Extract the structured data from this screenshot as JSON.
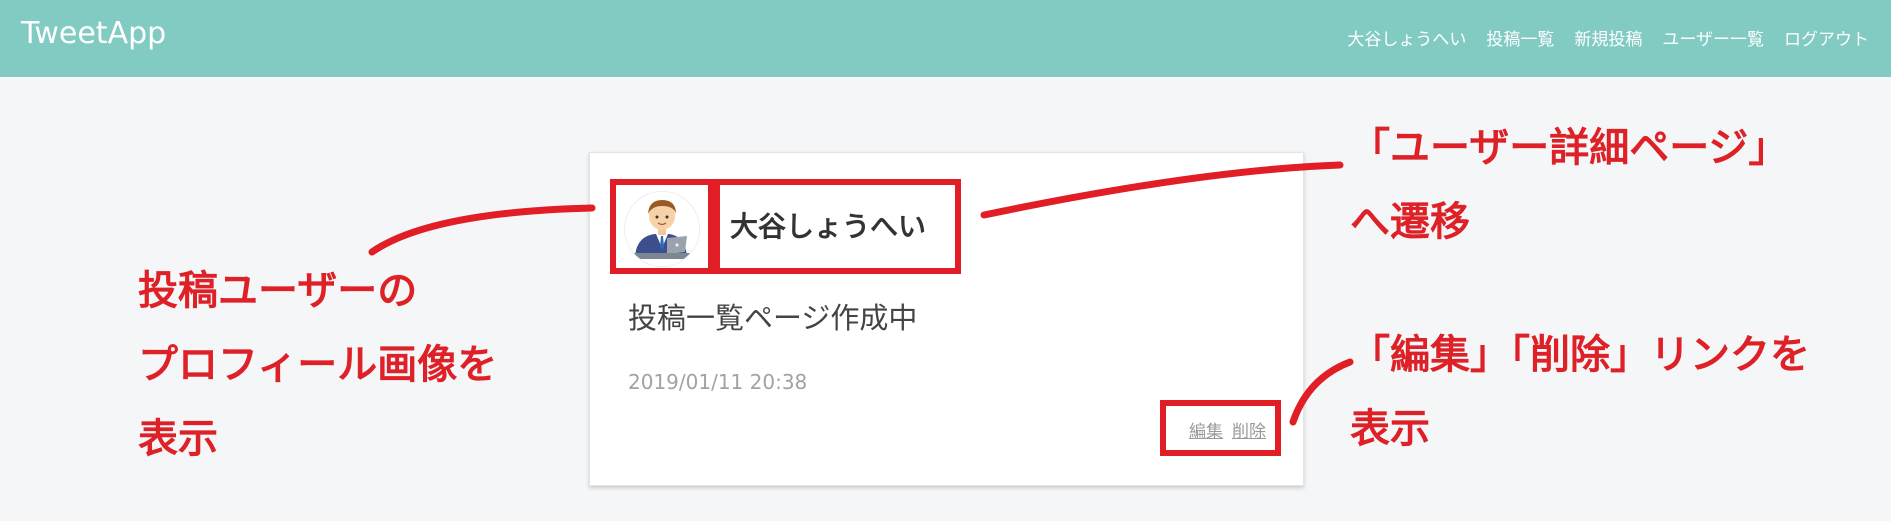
{
  "app": {
    "title": "TweetApp",
    "colors": {
      "header": "#82cbc3",
      "annotation": "#e11d25"
    }
  },
  "nav": {
    "items": [
      {
        "label": "大谷しょうへい"
      },
      {
        "label": "投稿一覧"
      },
      {
        "label": "新規投稿"
      },
      {
        "label": "ユーザー一覧"
      },
      {
        "label": "ログアウト"
      }
    ]
  },
  "post": {
    "avatar_icon": "user-avatar-businessman-laptop",
    "username": "大谷しょうへい",
    "content": "投稿一覧ページ作成中",
    "timestamp": "2019/01/11 20:38",
    "edit_label": "編集",
    "delete_label": "削除"
  },
  "annotations": {
    "left": [
      "投稿ユーザーの",
      "プロフィール画像を",
      "表示"
    ],
    "top_right": [
      "「ユーザー詳細ページ」",
      "へ遷移"
    ],
    "bottom_right": [
      "「編集」「削除」リンクを",
      "表示"
    ]
  }
}
